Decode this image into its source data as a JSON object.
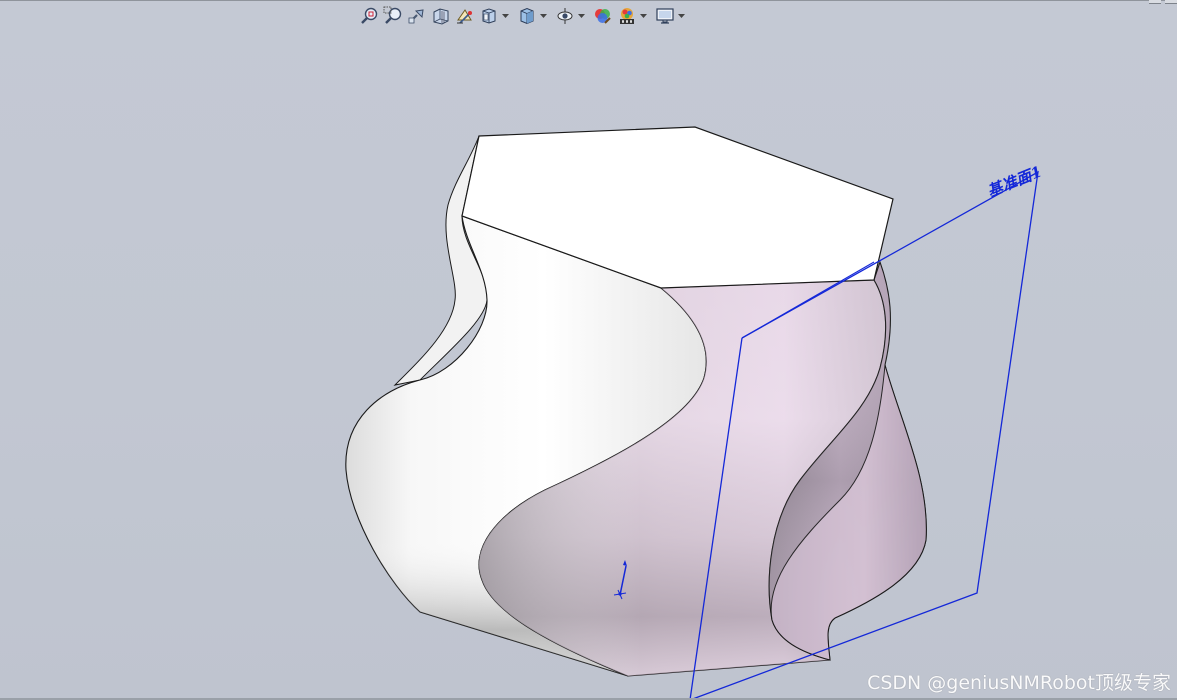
{
  "viewport": {
    "background_color": "#c3c8d3",
    "plane_color": "#1428d8"
  },
  "heads_up_toolbar": {
    "items": [
      {
        "icon": "zoom-to-fit-icon",
        "tooltip": ""
      },
      {
        "icon": "zoom-to-area-icon",
        "tooltip": ""
      },
      {
        "icon": "previous-view-icon",
        "tooltip": ""
      },
      {
        "icon": "section-view-icon",
        "tooltip": ""
      },
      {
        "icon": "dynamic-annotation-views-icon",
        "tooltip": ""
      },
      {
        "icon": "view-orientation-icon",
        "tooltip": "",
        "has_dropdown": true
      },
      {
        "icon": "display-style-icon",
        "tooltip": "",
        "has_dropdown": true
      },
      {
        "icon": "hide-show-items-icon",
        "tooltip": "",
        "has_dropdown": true
      },
      {
        "icon": "edit-appearance-icon",
        "tooltip": ""
      },
      {
        "icon": "apply-scene-icon",
        "tooltip": "",
        "has_dropdown": true
      },
      {
        "icon": "view-settings-icon",
        "tooltip": "",
        "has_dropdown": true
      }
    ]
  },
  "model": {
    "reference_plane_label": "基准面1",
    "face_colors": {
      "white_faces": "#ffffff",
      "pink_faces": "#cdb4cc",
      "edges": "#1a1a1a"
    }
  },
  "watermark": {
    "text": "CSDN @geniusNMRobot顶级专家"
  }
}
